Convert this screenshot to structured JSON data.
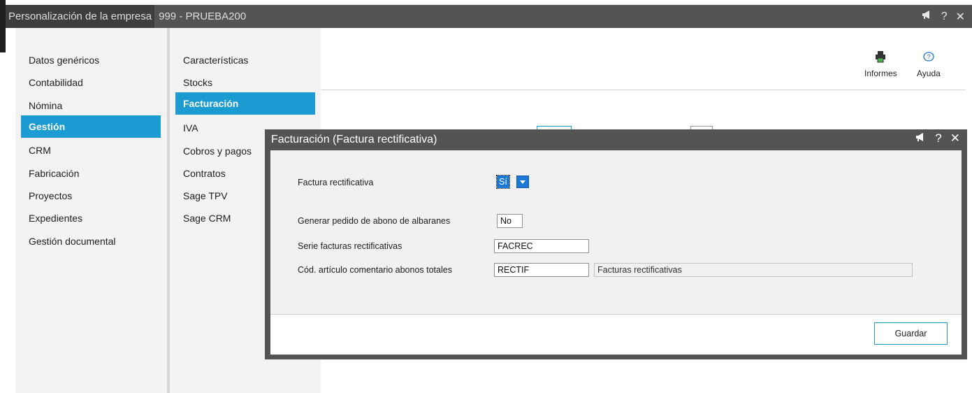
{
  "window": {
    "title_part1": "Personalización de la empresa",
    "title_part2": "999 - PRUEBA200"
  },
  "sidebar": {
    "items": [
      {
        "label": "Datos genéricos"
      },
      {
        "label": "Contabilidad"
      },
      {
        "label": "Nómina"
      },
      {
        "label": "Gestión",
        "active": true
      },
      {
        "label": "CRM"
      },
      {
        "label": "Fabricación"
      },
      {
        "label": "Proyectos"
      },
      {
        "label": "Expedientes"
      },
      {
        "label": "Gestión documental"
      }
    ]
  },
  "subnav": {
    "items": [
      {
        "label": "Características"
      },
      {
        "label": "Stocks"
      },
      {
        "label": "Facturación",
        "active": true
      },
      {
        "label": "IVA"
      },
      {
        "label": "Cobros y pagos"
      },
      {
        "label": "Contratos"
      },
      {
        "label": "Sage TPV"
      },
      {
        "label": "Sage CRM"
      }
    ]
  },
  "toolbar": {
    "reports_label": "Informes",
    "help_label": "Ayuda"
  },
  "dialog": {
    "title": "Facturación (Factura rectificativa)",
    "fields": {
      "factura_rectificativa": {
        "label": "Factura rectificativa",
        "value": "Sí"
      },
      "generar_pedido": {
        "label": "Generar pedido de abono de albaranes",
        "value": "No"
      },
      "serie": {
        "label": "Serie facturas rectificativas",
        "value": "FACREC"
      },
      "cod_articulo": {
        "label": "Cód. artículo comentario abonos totales",
        "value": "RECTIF",
        "description": "Facturas rectificativas"
      }
    },
    "save_label": "Guardar"
  },
  "colors": {
    "accent": "#1a9bd2",
    "titlebar": "#545454"
  }
}
